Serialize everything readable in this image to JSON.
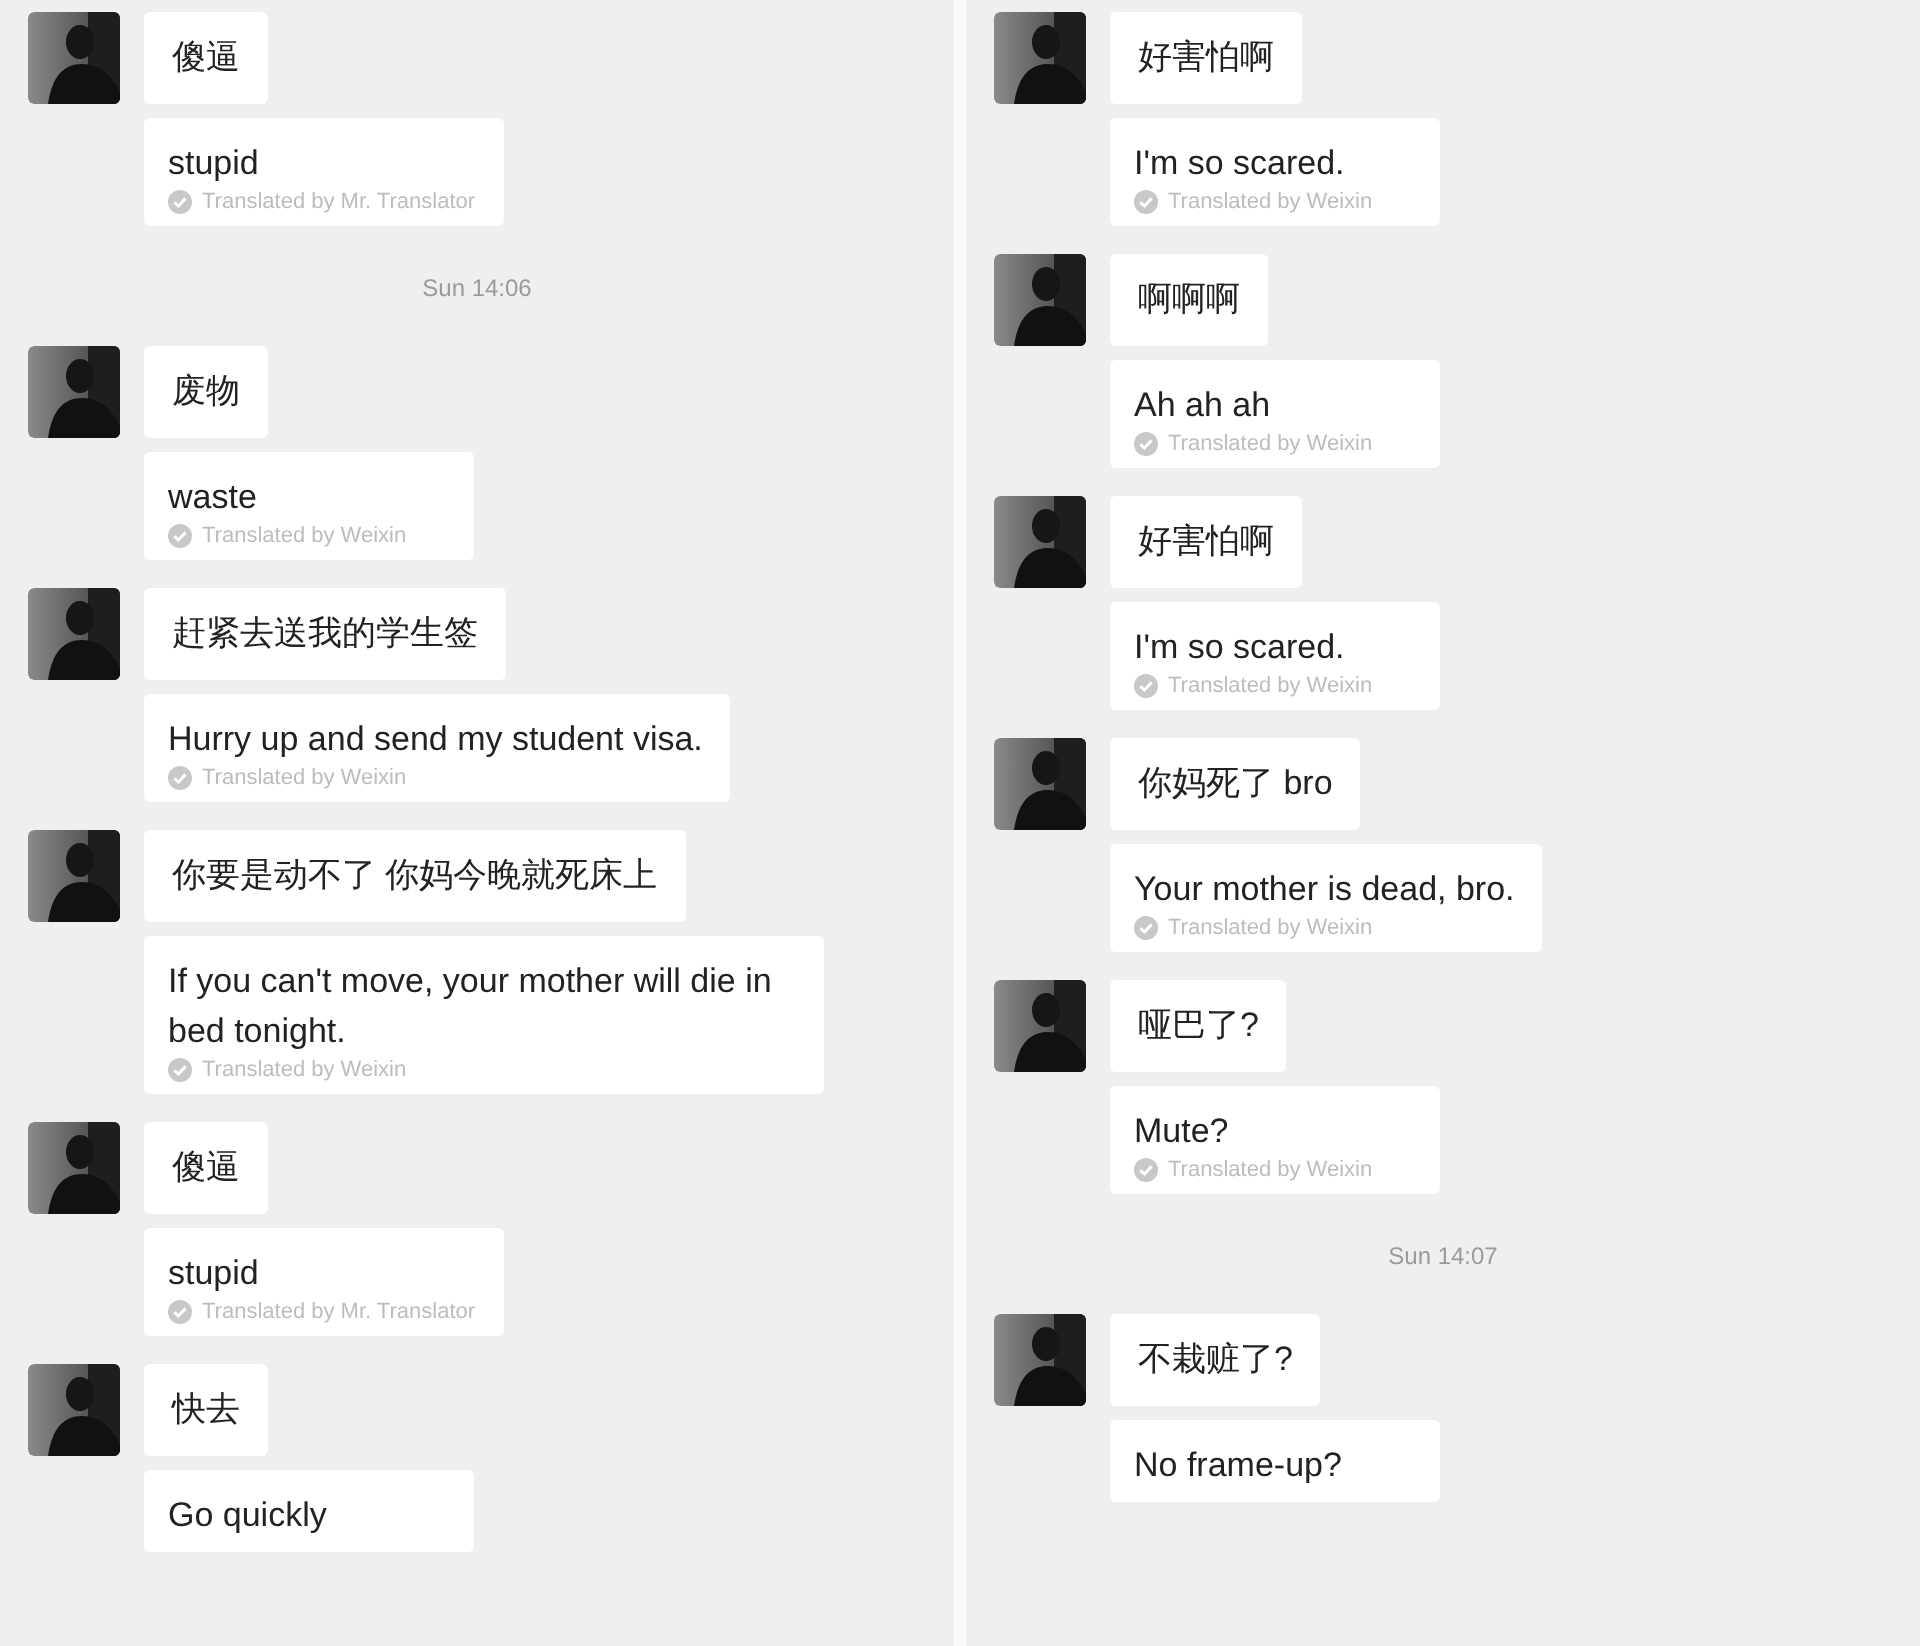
{
  "panels": [
    {
      "items": [
        {
          "kind": "message",
          "original": "傻逼",
          "translation": "stupid",
          "credit": "Translated by Mr. Translator"
        },
        {
          "kind": "time",
          "text": "Sun 14:06"
        },
        {
          "kind": "message",
          "original": "废物",
          "translation": "waste",
          "credit": "Translated by Weixin"
        },
        {
          "kind": "message",
          "original": "赶紧去送我的学生签",
          "translation": "Hurry up and send my student visa.",
          "credit": "Translated by Weixin"
        },
        {
          "kind": "message",
          "original": "你要是动不了 你妈今晚就死床上",
          "translation": "If you can't move, your mother will die in bed tonight.",
          "credit": "Translated by Weixin"
        },
        {
          "kind": "message",
          "original": "傻逼",
          "translation": "stupid",
          "credit": "Translated by Mr. Translator"
        },
        {
          "kind": "message",
          "original": "快去",
          "translation": "Go quickly"
        }
      ]
    },
    {
      "items": [
        {
          "kind": "message",
          "original": "好害怕啊",
          "translation": "I'm so scared.",
          "credit": "Translated by Weixin"
        },
        {
          "kind": "message",
          "original": "啊啊啊",
          "translation": "Ah ah ah",
          "credit": "Translated by Weixin"
        },
        {
          "kind": "message",
          "original": "好害怕啊",
          "translation": "I'm so scared.",
          "credit": "Translated by Weixin"
        },
        {
          "kind": "message",
          "original": "你妈死了 bro",
          "translation": "Your mother is dead, bro.",
          "credit": "Translated by Weixin"
        },
        {
          "kind": "message",
          "original": "哑巴了?",
          "translation": "Mute?",
          "credit": "Translated by Weixin"
        },
        {
          "kind": "time",
          "text": "Sun 14:07"
        },
        {
          "kind": "message",
          "original": "不栽赃了?",
          "translation": "No frame-up?"
        }
      ]
    }
  ]
}
